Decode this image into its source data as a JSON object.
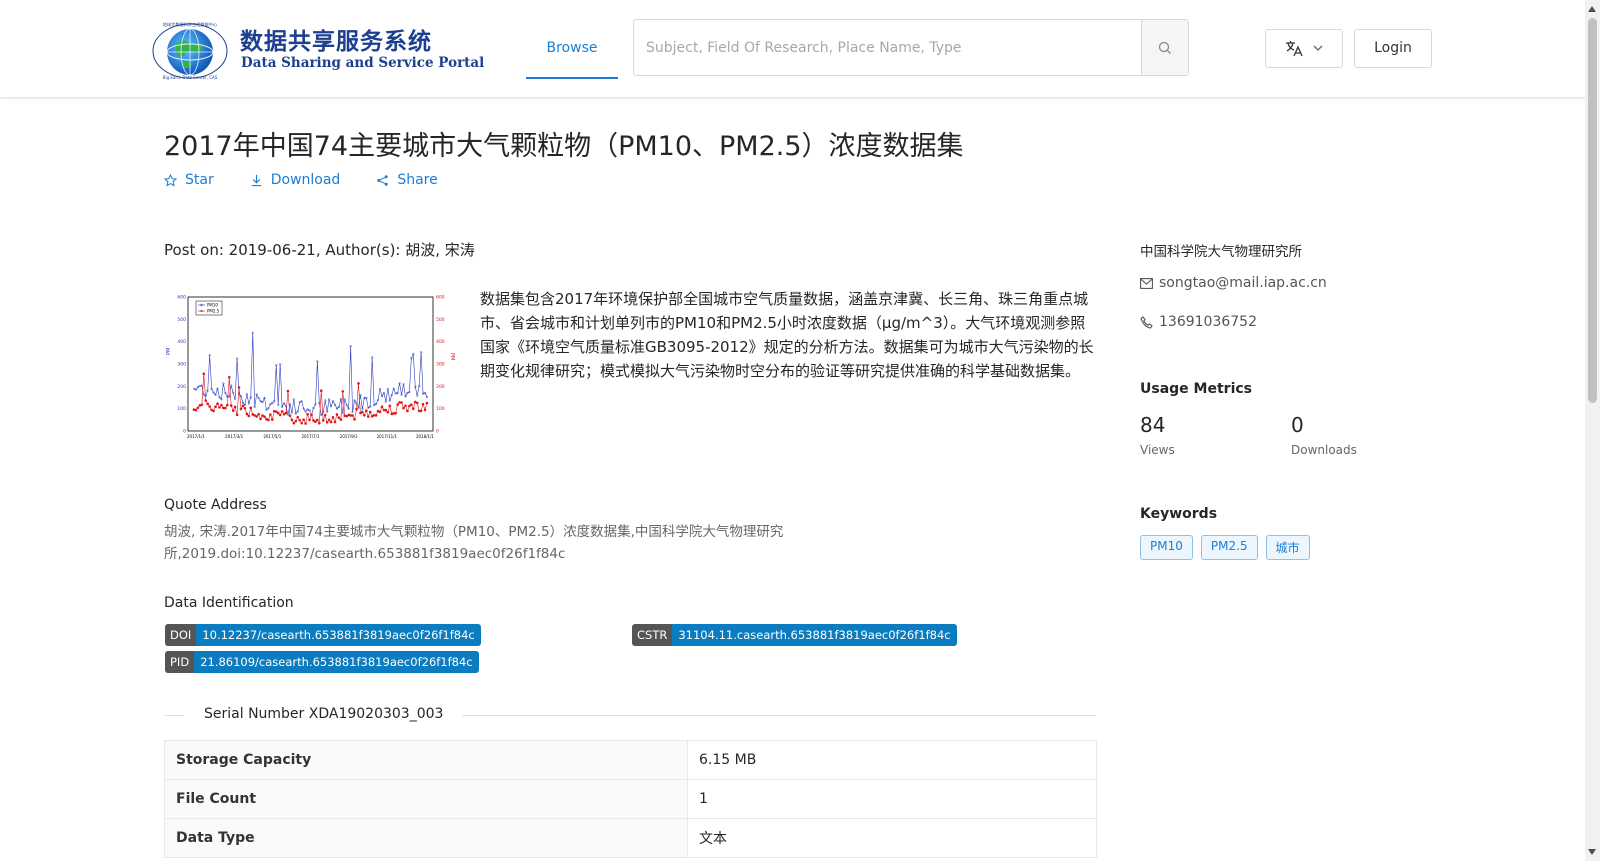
{
  "header": {
    "logo_cn": "数据共享服务系统",
    "logo_en": "Data Sharing and Service Portal",
    "logo_ring_text": "地球大数据科学工程数据中心",
    "logo_ring_text_bottom": "Big Earth Data Center, CAS",
    "nav_browse": "Browse",
    "search_placeholder": "Subject, Field Of Research, Place Name, Type",
    "login": "Login"
  },
  "dataset": {
    "title": "2017年中国74主要城市大气颗粒物（PM10、PM2.5）浓度数据集",
    "actions": {
      "star": "Star",
      "download": "Download",
      "share": "Share"
    },
    "post_prefix": "Post on: ",
    "post_date": "2019-06-21",
    "author_prefix": ", Author(s): ",
    "authors": "胡波, 宋涛",
    "description": "数据集包含2017年环境保护部全国城市空气质量数据，涵盖京津冀、长三角、珠三角重点城市、省会城市和计划单列市的PM10和PM2.5小时浓度数据（μg/m^3）。大气环境观测参照国家《环境空气质量标准GB3095-2012》规定的分析方法。数据集可为城市大气污染物的长期变化规律研究；模式模拟大气污染物时空分布的验证等研究提供准确的科学基础数据集。",
    "quote_label": "Quote Address",
    "quote": "胡波, 宋涛.2017年中国74主要城市大气颗粒物（PM10、PM2.5）浓度数据集,中国科学院大气物理研究所,2019.doi:10.12237/casearth.653881f3819aec0f26f1f84c",
    "ident_label": "Data Identification",
    "doi_key": "DOI",
    "doi": "10.12237/casearth.653881f3819aec0f26f1f84c",
    "cstr_key": "CSTR",
    "cstr": "31104.11.casearth.653881f3819aec0f26f1f84c",
    "pid_key": "PID",
    "pid": "21.86109/casearth.653881f3819aec0f26f1f84c",
    "serial": "Serial Number XDA19020303_003",
    "table": [
      {
        "key": "Storage Capacity",
        "value": "6.15 MB"
      },
      {
        "key": "File Count",
        "value": "1"
      },
      {
        "key": "Data Type",
        "value": "文本"
      }
    ]
  },
  "thumbnail": {
    "legend": [
      "PM10",
      "PM2.5"
    ],
    "left_ticks": [
      "600",
      "500",
      "400",
      "300",
      "200",
      "100",
      "0"
    ],
    "right_ticks": [
      "600",
      "500",
      "400",
      "300",
      "200",
      "100",
      "0"
    ],
    "left_label": "PM",
    "right_label": "PM",
    "x_ticks": [
      "2017/1/1",
      "2017/3/1",
      "2017/5/1",
      "2017/7/1",
      "2017/9/1",
      "2017/11/1",
      "2018/1/1"
    ],
    "colors": {
      "pm10": "#2b3dbf",
      "pm25": "#e0161a"
    }
  },
  "sidebar": {
    "institution": "中国科学院大气物理研究所",
    "email": "songtao@mail.iap.ac.cn",
    "phone": "13691036752",
    "usage_title": "Usage Metrics",
    "views": "84",
    "views_label": "Views",
    "downloads": "0",
    "downloads_label": "Downloads",
    "keywords_title": "Keywords",
    "keywords": [
      "PM10",
      "PM2.5",
      "城市"
    ]
  },
  "colors": {
    "accent": "#1a7fd4",
    "tag_value": "#0b7cc0",
    "tag_key": "#555555"
  }
}
